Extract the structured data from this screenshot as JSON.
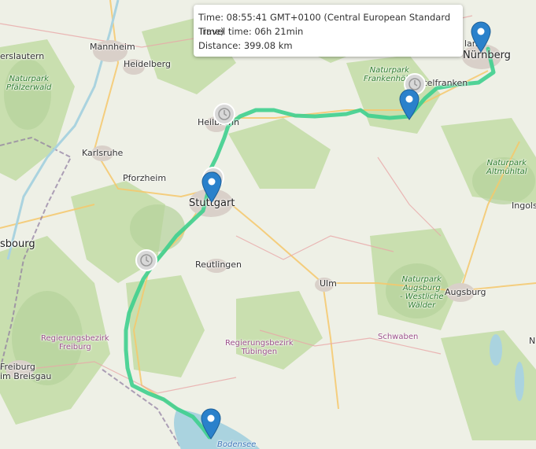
{
  "popup": {
    "time_line": "Time: 08:55:41 GMT+0100 (Central European Standard Time)",
    "travel_line": "Travel time: 06h 21min",
    "distance_line": "Distance: 399.08 km"
  },
  "colors": {
    "route": "#3ecf8e",
    "marker": "#2a81cb",
    "forest": "#c9dfaf",
    "water": "#aad3df"
  },
  "labels": {
    "kaiserslautern": "erslautern",
    "mannheim": "Mannheim",
    "heidelberg": "Heidelberg",
    "park_pfaelzerwald": "Naturpark\nPfälzerwald",
    "karlsruhe": "Karlsruhe",
    "pforzheim": "Pforzheim",
    "heilbronn": "Heilbronn",
    "stuttgart": "Stuttgart",
    "strasbourg": "sbourg",
    "reutlingen": "Reutlingen",
    "ulm": "Ulm",
    "augsburg": "Augsburg",
    "ingolstadt": "Ingols",
    "nuernberg": "Nürnberg",
    "nuernberg_prefix": "lan",
    "mittelfranken": "ttelfranken",
    "park_frankenhoehe": "Naturpark\nFrankenhöhe",
    "park_altmuehltal": "Naturpark\nAltmühltal",
    "park_augsburg": "Naturpark\nAugsburg\n- Westliche\nWälder",
    "schwaben": "Schwaben",
    "region_freiburg": "Regierungsbezirk\nFreiburg",
    "region_tuebingen": "Regierungsbezirk\nTübingen",
    "freiburg": "Freiburg\nim Breisgau",
    "bodensee": "Bodensee",
    "n_edge": "N"
  },
  "markers": [
    "nuernberg-marker",
    "feuchtwangen-marker",
    "stuttgart-marker",
    "bodensee-marker"
  ],
  "waypoint_icons": [
    "clock-icon-heilbronn",
    "clock-icon-stuttgart",
    "clock-icon-tuebingen",
    "clock-icon-frankenhoehe"
  ]
}
